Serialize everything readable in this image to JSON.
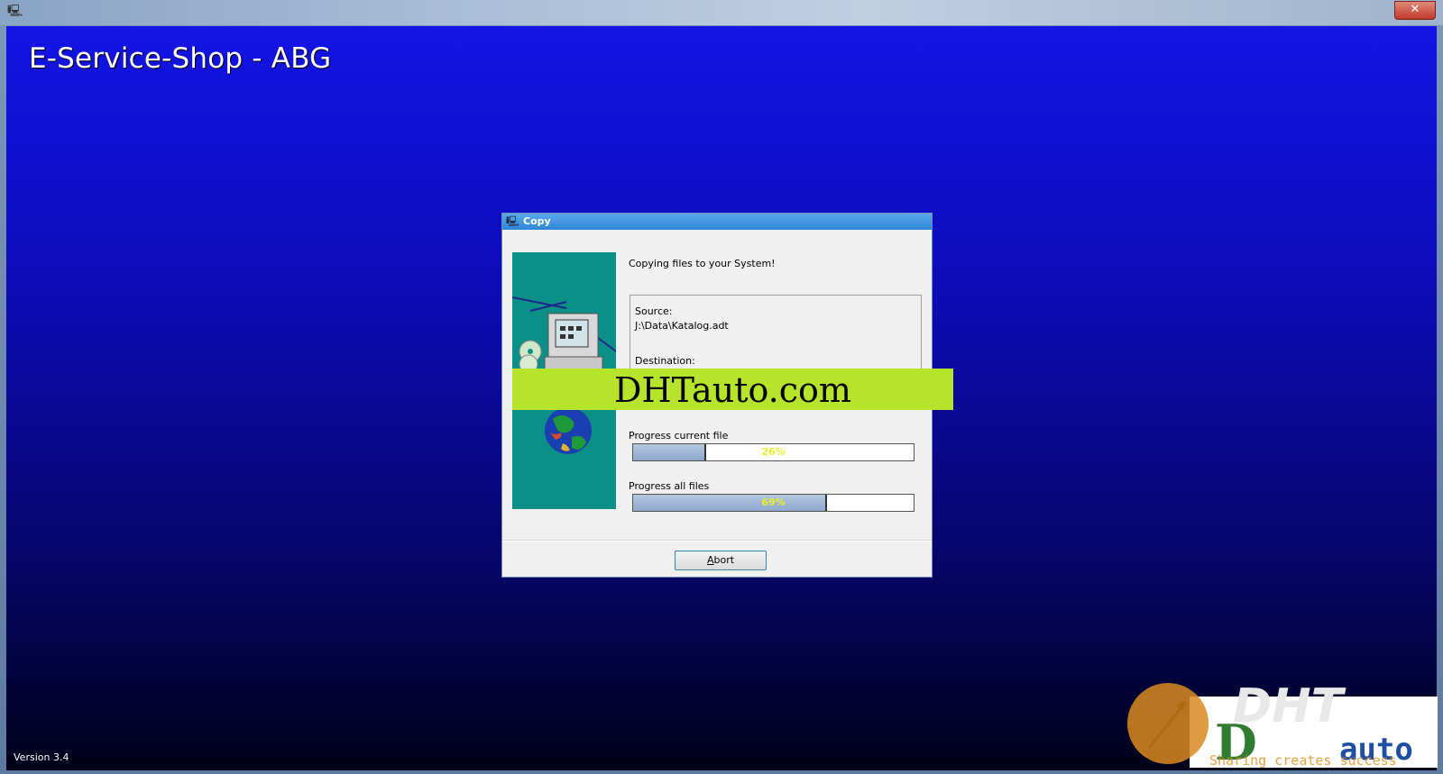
{
  "window": {
    "app_icon": "computer-icon",
    "close_label": "✕"
  },
  "app": {
    "title": "E-Service-Shop - ABG",
    "version": "Version 3.4"
  },
  "dialog": {
    "title": "Copy",
    "icon": "computer-icon",
    "message": "Copying files to your System!",
    "source_label": "Source:",
    "source_path": "J:\\Data\\Katalog.adt",
    "destination_label": "Destination:",
    "progress_current_label": "Progress current file",
    "progress_current_value": 26,
    "progress_current_text": "26%",
    "progress_all_label": "Progress all files",
    "progress_all_value": 69,
    "progress_all_text": "69%",
    "abort_label": "bort",
    "abort_accel": "A"
  },
  "watermark": {
    "text": "DHTauto.com"
  },
  "logo": {
    "brand_shadow": "DHT",
    "brand_main_left": "D",
    "brand_main_right": "auto",
    "tagline": "Sharing creates success",
    "colors": {
      "orange": "#e08a1a",
      "green": "#2e7d32",
      "blue": "#1e4fa3"
    }
  }
}
